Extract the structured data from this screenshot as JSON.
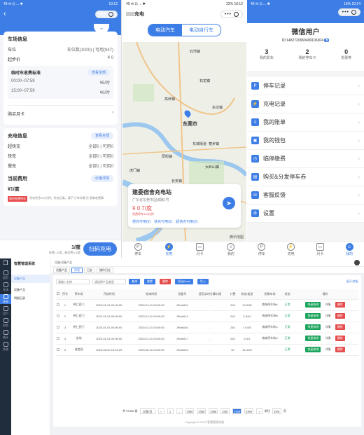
{
  "status_bar": {
    "left": "49 ✉ ⊡ ... ✱",
    "p1_time": "10:12",
    "p2_time": "22%  10:12",
    "p3_time": "16%  10:14"
  },
  "p1": {
    "parking_info_title": "车场信息",
    "spot_label": "车位",
    "spot_value": "车位数(1000) | 可用(947)",
    "start_price_label": "起步价",
    "start_price_value": "¥ 0",
    "temp_title": "临时车收费标准",
    "view_all": "查看全部",
    "rates": [
      {
        "time": "00:00~07:59",
        "price": "¥5/时"
      },
      {
        "time": "15:00~07:59",
        "price": "¥0/时"
      }
    ],
    "monthly": "购买月卡",
    "charge_info_title": "充电信息",
    "view_more": "查看全部",
    "chargers": [
      {
        "name": "超快充",
        "value": "全部0 | 可用0"
      },
      {
        "name": "快充",
        "value": "全部0 | 可用0"
      },
      {
        "name": "慢充",
        "value": "全部1 | 可用0"
      }
    ],
    "current_fee_title": "当前费用",
    "price_detail": "价格详情",
    "current_fee": "¥1/度",
    "tag": "限时免费停车",
    "note": "免电免停120分钟，免电后离，请子 订单详情 页 限勒收费事",
    "footer_price": "1/度",
    "footer_sub": "电费1.0/度，服务费0.0/度",
    "scan_button": "扫码充电"
  },
  "p2": {
    "title": "充电",
    "tabs": [
      "电动汽车",
      "电动自行车"
    ],
    "map_labels": [
      "石湾镇",
      "石龙镇",
      "高埗镇",
      "东莞市",
      "东坑镇",
      "寮步镇",
      "东城街道",
      "大岭山镇",
      "虎门镇",
      "厚街镇",
      "长安镇"
    ],
    "station_name": "建委宿舍充电站",
    "station_addr": "广东省东莞市园城路1号",
    "station_price": "¥ 0.7/度",
    "station_free": "免费停车120分钟",
    "avail": [
      "慢充可用(0)",
      "快充可用(0)",
      "超快充可用(0)"
    ],
    "map_credit": "腾讯地图",
    "tabbar": [
      "停车",
      "充电",
      "月卡",
      "我的"
    ]
  },
  "p3": {
    "user_title": "微信用户",
    "user_id": "ID:1482720659499106304",
    "stats": [
      {
        "num": "3",
        "label": "我的爱车"
      },
      {
        "num": "2",
        "label": "我的停车卡"
      },
      {
        "num": "0",
        "label": "优惠券"
      }
    ],
    "menu": [
      "停车记录",
      "充电记录",
      "我的账单",
      "我的钱包",
      "临停缴费",
      "购买&分发停车券",
      "客服反馈",
      "设置"
    ],
    "tabbar": [
      "停车",
      "充电",
      "月卡",
      "我的"
    ]
  },
  "p4": {
    "app_title": "智慧管理系统",
    "sidebar": [
      "首页",
      "车场",
      "充电",
      "用户",
      "财务",
      "统计",
      "系统"
    ],
    "menu_items": [
      "设备产品",
      "设备产品",
      "明细记录"
    ],
    "breadcrumb": "设备/设备产品",
    "tabs": [
      "设备产品",
      "列表",
      "日志",
      "操作日志"
    ],
    "filter_placeholders": [
      "请输入名称",
      "请选择产品类型"
    ],
    "buttons": [
      "查询",
      "重置",
      "删除",
      "导出Excel",
      "导入"
    ],
    "right_tools": "展开/收起",
    "columns": [
      "序号",
      "停车场",
      "开始时间",
      "结束时间",
      "设备号",
      "是否实时计算价格",
      "计费",
      "状态/类型",
      "所属车场",
      "状态",
      "操作"
    ],
    "rows": [
      {
        "i": "1",
        "name": "明仁西门",
        "start": "2020-01-01 00:00:00",
        "end": "2020-01-01 00:00:00",
        "dev": "JPark001",
        "real": "-",
        "fee": "240",
        "type": "10-0/30",
        "lot": "南城停车场A",
        "status": "正常"
      },
      {
        "i": "2",
        "name": "明仁西门",
        "start": "2020-01-01 00:00:00",
        "end": "2020-01-01 00:00:00",
        "dev": "JPark014",
        "real": "-",
        "fee": "240",
        "type": "2-0/40",
        "lot": "南城停车场B",
        "status": "正常"
      },
      {
        "i": "3",
        "name": "明仁西门",
        "start": "2020-01-01 00:00:00",
        "end": "2020-01-01 00:00:00",
        "dev": "JPark016",
        "real": "-",
        "fee": "240",
        "type": "1Y-0/0",
        "lot": "南城停车场C",
        "status": "正常"
      },
      {
        "i": "4",
        "name": "金地",
        "start": "2020-01-01 00:00:00",
        "end": "2020-01-01 00:00:00",
        "dev": "JPark017",
        "real": "-",
        "fee": "240",
        "type": "2-0/1",
        "lot": "南城停车场D",
        "status": "正常"
      },
      {
        "i": "5",
        "name": "诚信园",
        "start": "2020-06-20 19:44:29",
        "end": "2020-06-20 23:59:59",
        "dev": "JPark023",
        "real": "-",
        "fee": "30",
        "type": "15-1/04",
        "lot": "-",
        "status": "正常"
      }
    ],
    "actions": [
      "快速修改",
      "详情",
      "删除"
    ],
    "pager": {
      "total": "共 97040 条",
      "size": "20条/页",
      "pages": [
        "1",
        "...",
        "3380",
        "3385",
        "3386",
        "3387",
        "3388",
        "3390"
      ],
      "goto": "前往",
      "page_val": "3391",
      "page_suffix": "页"
    },
    "footer": "Copyright © 2022 智慧管理系统"
  },
  "colors": {
    "accent": "#3d7ee6",
    "green": "#1aa35b",
    "red": "#e54c4c",
    "orange": "#f0a030"
  }
}
